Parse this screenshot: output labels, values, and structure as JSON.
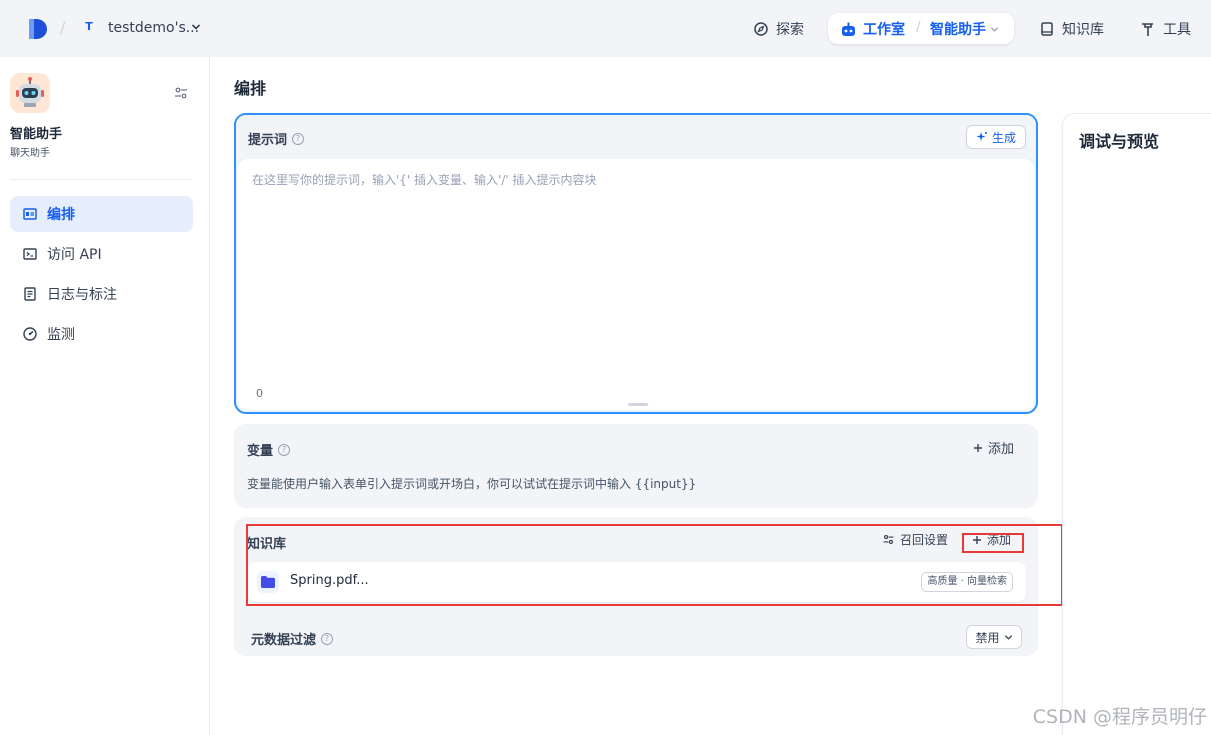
{
  "topbar": {
    "workspace_badge": "T",
    "workspace_name": "testdemo's...",
    "nav": {
      "explore": "探索",
      "studio": "工作室",
      "current_app": "智能助手",
      "knowledge": "知识库",
      "tools": "工具"
    }
  },
  "sidebar": {
    "app_name": "智能助手",
    "app_type": "聊天助手",
    "items": [
      {
        "label": "编排",
        "icon": "layout-icon",
        "active": true
      },
      {
        "label": "访问 API",
        "icon": "terminal-icon",
        "active": false
      },
      {
        "label": "日志与标注",
        "icon": "file-list-icon",
        "active": false
      },
      {
        "label": "监测",
        "icon": "dashboard-icon",
        "active": false
      }
    ]
  },
  "main": {
    "title": "编排",
    "prompt": {
      "title": "提示词",
      "generate_label": "生成",
      "placeholder": "在这里写你的提示词，输入'{' 插入变量、输入'/' 插入提示内容块",
      "char_count": "0"
    },
    "variables": {
      "title": "变量",
      "add_label": "添加",
      "description": "变量能使用户输入表单引入提示词或开场白，你可以试试在提示词中输入 {{input}}"
    },
    "knowledge": {
      "title": "知识库",
      "recall_label": "召回设置",
      "add_label": "添加",
      "items": [
        {
          "name": "Spring.pdf...",
          "tag": "高质量 · 向量检索"
        }
      ],
      "metadata_filter": {
        "title": "元数据过滤",
        "value": "禁用"
      }
    }
  },
  "debug": {
    "title": "调试与预览"
  },
  "watermark": "CSDN @程序员明仔",
  "colors": {
    "accent": "#155eef",
    "highlight_box": "#e5393a",
    "prompt_border": "#2e90fa"
  }
}
